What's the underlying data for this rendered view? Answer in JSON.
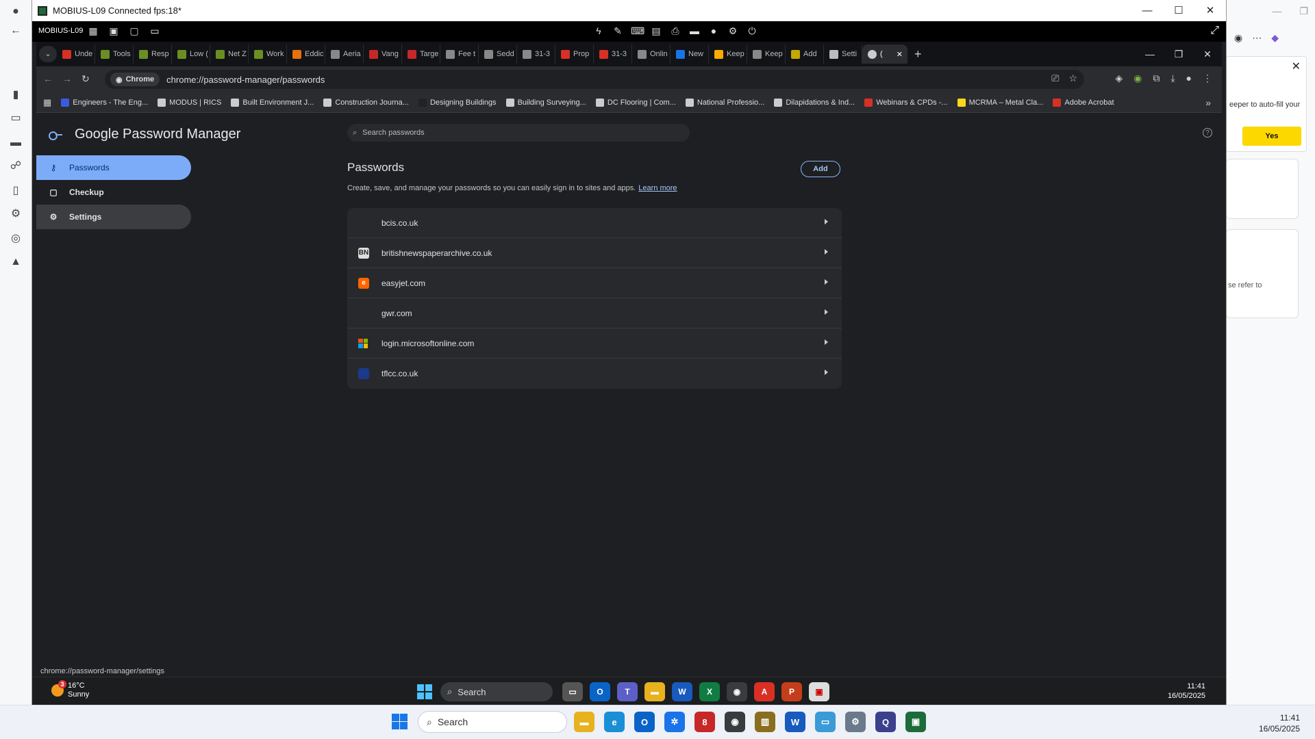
{
  "remote_window": {
    "title": "MOBIUS-L09 Connected fps:18*",
    "toolbar_label": "MOBIUS-L09"
  },
  "chrome": {
    "tabs": [
      {
        "label": "Unde",
        "color": "#d93025"
      },
      {
        "label": "Tools",
        "color": "#6b8e23"
      },
      {
        "label": "Resp",
        "color": "#6b8e23"
      },
      {
        "label": "Low (",
        "color": "#6b8e23"
      },
      {
        "label": "Net Z",
        "color": "#6b8e23"
      },
      {
        "label": "Work",
        "color": "#6b8e23"
      },
      {
        "label": "Eddic",
        "color": "#e8710a"
      },
      {
        "label": "Aeria",
        "color": "#888888"
      },
      {
        "label": "Vang",
        "color": "#c62828"
      },
      {
        "label": "Targe",
        "color": "#c62828"
      },
      {
        "label": "Fee t",
        "color": "#888888"
      },
      {
        "label": "Sedd",
        "color": "#888888"
      },
      {
        "label": "31-3",
        "color": "#888888"
      },
      {
        "label": "Prop",
        "color": "#d93025"
      },
      {
        "label": "31-3",
        "color": "#d93025"
      },
      {
        "label": "Onlin",
        "color": "#888888"
      },
      {
        "label": "New",
        "color": "#1a73e8"
      },
      {
        "label": "Keep",
        "color": "#f9ab00"
      },
      {
        "label": "Keep",
        "color": "#888888"
      },
      {
        "label": "Add",
        "color": "#c6a700"
      },
      {
        "label": "Setti",
        "color": "#bbbbbb"
      }
    ],
    "active_tab_label": "(",
    "address_chip": "Chrome",
    "url": "chrome://password-manager/passwords",
    "bookmarks": [
      {
        "label": "Engineers - The Eng...",
        "color": "#3b5bdb"
      },
      {
        "label": "MODUS | RICS",
        "color": "#cccccc"
      },
      {
        "label": "Built Environment J...",
        "color": "#cccccc"
      },
      {
        "label": "Construction Journa...",
        "color": "#cccccc"
      },
      {
        "label": "Designing Buildings",
        "color": "#222222"
      },
      {
        "label": "Building Surveying...",
        "color": "#cccccc"
      },
      {
        "label": "DC Flooring | Com...",
        "color": "#cccccc"
      },
      {
        "label": "National Professio...",
        "color": "#cccccc"
      },
      {
        "label": "Dilapidations & Ind...",
        "color": "#cccccc"
      },
      {
        "label": "Webinars & CPDs -...",
        "color": "#d93025"
      },
      {
        "label": "MCRMA – Metal Cla...",
        "color": "#f9d71c"
      },
      {
        "label": "Adobe Acrobat",
        "color": "#d93025"
      }
    ],
    "status_url": "chrome://password-manager/settings"
  },
  "pm": {
    "app_title": "Google Password Manager",
    "search_placeholder": "Search passwords",
    "nav": [
      {
        "label": "Passwords"
      },
      {
        "label": "Checkup"
      },
      {
        "label": "Settings"
      }
    ],
    "section_title": "Passwords",
    "add_label": "Add",
    "description": "Create, save, and manage your passwords so you can easily sign in to sites and apps.",
    "learn_more": "Learn more",
    "sites": [
      {
        "name": "bcis.co.uk",
        "fav_color": "#28292c",
        "glyph": ""
      },
      {
        "name": "britishnewspaperarchive.co.uk",
        "fav_color": "#dddddd",
        "glyph": "BN"
      },
      {
        "name": "easyjet.com",
        "fav_color": "#ff6600",
        "glyph": "e"
      },
      {
        "name": "gwr.com",
        "fav_color": "#28292c",
        "glyph": ""
      },
      {
        "name": "login.microsoftonline.com",
        "fav_color": "",
        "glyph": ""
      },
      {
        "name": "tflcc.co.uk",
        "fav_color": "#1a3a8c",
        "glyph": ""
      }
    ]
  },
  "remote_taskbar": {
    "temp": "16°C",
    "weather": "Sunny",
    "badge": "3",
    "search": "Search",
    "time": "11:41",
    "date": "16/05/2025"
  },
  "host": {
    "popup_text": "eeper to auto-fill your",
    "popup_yes": "Yes",
    "card_text": "se refer to",
    "taskbar_search": "Search",
    "time": "11:41",
    "date": "16/05/2025"
  }
}
